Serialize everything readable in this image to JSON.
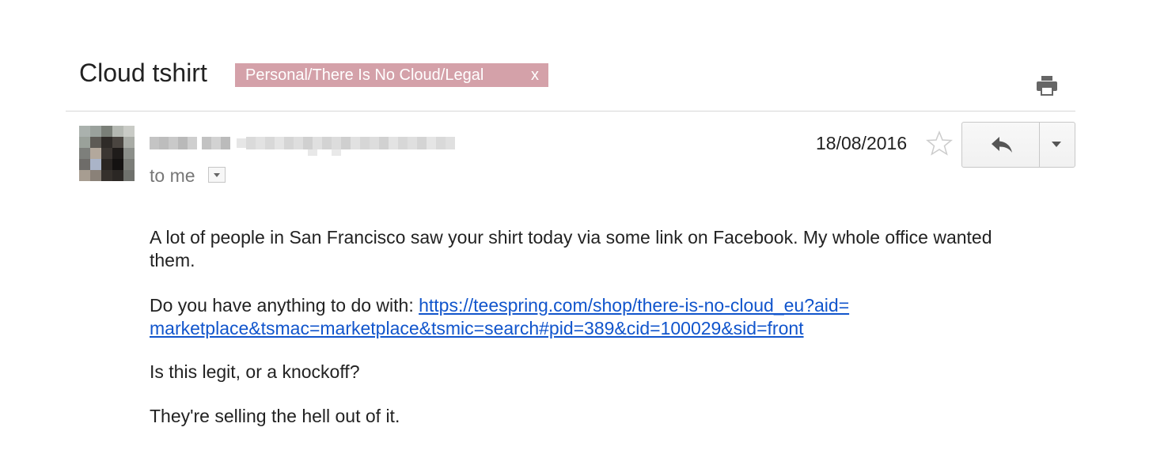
{
  "header": {
    "subject": "Cloud tshirt",
    "label": {
      "text": "Personal/There Is No Cloud/Legal",
      "close": "x",
      "color": "#d4a1a9"
    }
  },
  "icons": {
    "print": "print-icon",
    "star": "star-icon",
    "reply": "reply-icon",
    "more": "chevron-down-icon",
    "recipient_details": "chevron-down-icon"
  },
  "message": {
    "sender": "",
    "recipient": "to me",
    "date": "18/08/2016",
    "body": {
      "p1": "A lot of people in San Francisco saw your shirt today via some link on Facebook.  My whole office wanted them.",
      "p2_prefix": "Do you have anything to do with: ",
      "p2_link_line1": "https://teespring.com/shop/there-is-no-cloud_eu?aid=",
      "p2_link_line2": "marketplace&tsmac=marketplace&tsmic=search#pid=389&cid=100029&sid=front",
      "p3": "Is this legit, or a knockoff?",
      "p4": "They're selling the hell out of it."
    }
  },
  "colors": {
    "link": "#1155cc",
    "text": "#222222",
    "muted": "#777777",
    "divider": "#d8d8d8"
  }
}
